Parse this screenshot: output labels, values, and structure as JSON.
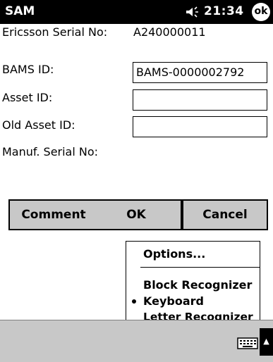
{
  "titlebar": {
    "app_name": "SAM",
    "time": "21:34",
    "ok_label": "ok"
  },
  "form": {
    "ericsson_serial": {
      "label": "Ericsson Serial No:",
      "value": "A240000011"
    },
    "bams_id": {
      "label": "BAMS ID:",
      "value": "BAMS-0000002792"
    },
    "asset_id": {
      "label": "Asset ID:",
      "value": ""
    },
    "old_asset_id": {
      "label": "Old Asset ID:",
      "value": ""
    },
    "manuf_serial": {
      "label": "Manuf. Serial No:",
      "value": ""
    }
  },
  "buttons": {
    "comment": "Comment",
    "ok": "OK",
    "cancel": "Cancel"
  },
  "input_menu": {
    "options": "Options...",
    "items": [
      {
        "label": "Block Recognizer",
        "selected": false
      },
      {
        "label": "Keyboard",
        "selected": true
      },
      {
        "label": "Letter Recognizer",
        "selected": false
      }
    ]
  },
  "icons": {
    "speaker": "speaker-icon",
    "keyboard": "keyboard-icon",
    "sip_arrow": "up-arrow-icon"
  }
}
